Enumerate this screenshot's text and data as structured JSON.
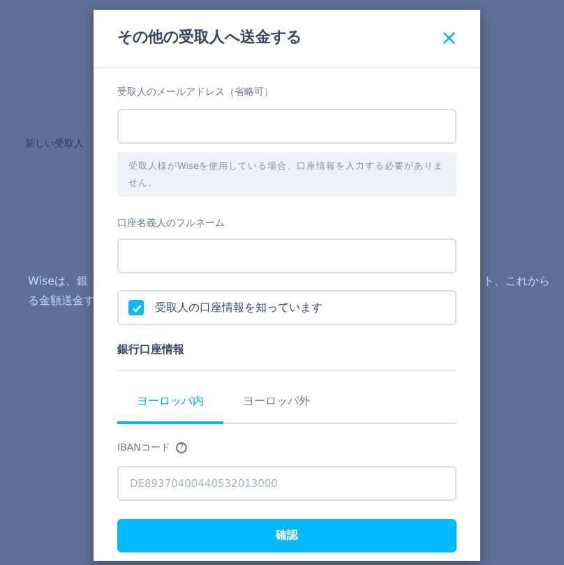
{
  "background": {
    "label": "新しい受取人",
    "link_left": [
      "Wiseは、銀",
      "る金額送金す"
    ],
    "link_right": [
      "ト、これから"
    ]
  },
  "modal": {
    "title": "その他の受取人へ送金する",
    "close": "×",
    "email": {
      "label": "受取人のメールアドレス（省略可）"
    },
    "note": "受取人様がWiseを使用している場合、口座情報を入力する必要がありません。",
    "name": {
      "label": "口座名義人のフルネーム"
    },
    "know_details": {
      "label": "受取人の口座情報を知っています",
      "checked": true
    },
    "section": "銀行口座情報",
    "tabs": [
      {
        "label": "ヨーロッパ内",
        "selected": true
      },
      {
        "label": "ヨーロッパ外",
        "selected": false
      }
    ],
    "iban": {
      "label": "IBANコード",
      "help": "?",
      "placeholder": "DE89370400440532013000"
    },
    "confirm": "確認"
  }
}
